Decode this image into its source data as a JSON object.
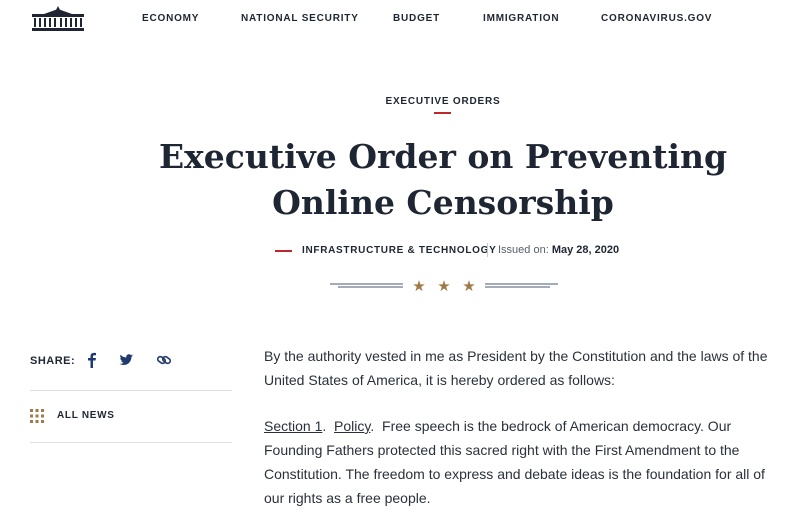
{
  "header": {
    "logo_icon": "white-house-logo-icon",
    "nav": [
      "ECONOMY",
      "NATIONAL SECURITY",
      "BUDGET",
      "IMMIGRATION",
      "CORONAVIRUS.GOV"
    ]
  },
  "article": {
    "eyebrow": "EXECUTIVE ORDERS",
    "title_line1": "Executive Order on Preventing",
    "title_line2": "Online Censorship",
    "category": "INFRASTRUCTURE & TECHNOLOGY",
    "issued_label": "Issued on:",
    "issued_date": "May 28, 2020",
    "intro": "By the authority vested in me as President by the Constitution and the laws of the United States of America, it is hereby ordered as follows:",
    "section_label": "Section 1",
    "section_title": "Policy",
    "section_text": "Free speech is the bedrock of American democracy.  Our Founding Fathers protected this sacred right with the First Amendment to the Constitution.  The freedom to express and debate ideas is the foundation for all of our rights as a free people."
  },
  "sidebar": {
    "share_label": "SHARE:",
    "share_icons": [
      "facebook-icon",
      "twitter-icon",
      "link-icon"
    ],
    "all_news": "ALL NEWS"
  },
  "colors": {
    "accent_red": "#c0272d",
    "navy": "#1f2633",
    "star_gold": "#a07a4a"
  }
}
